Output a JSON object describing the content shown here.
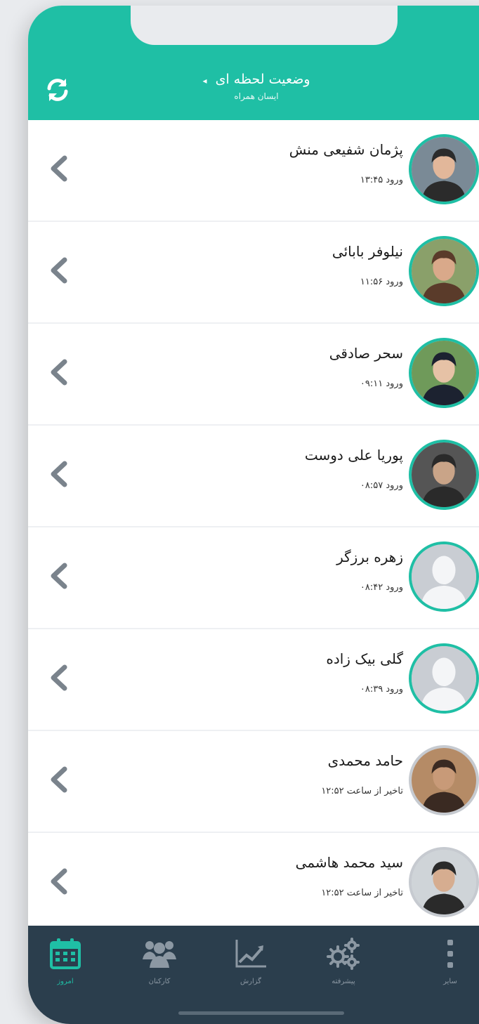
{
  "header": {
    "title": "وضعیت لحظه ای",
    "title_caret": "◂",
    "subtitle": "ایسان همراه"
  },
  "employees": [
    {
      "name": "پژمان شفیعی منش",
      "status": "ورود ۱۳:۴۵",
      "avatar": "photo",
      "border": "green"
    },
    {
      "name": "نیلوفر بابائی",
      "status": "ورود ۱۱:۵۶",
      "avatar": "photo",
      "border": "green"
    },
    {
      "name": "سحر صادقی",
      "status": "ورود ۰۹:۱۱",
      "avatar": "photo",
      "border": "green"
    },
    {
      "name": "پوریا علی دوست",
      "status": "ورود ۰۸:۵۷",
      "avatar": "photo",
      "border": "green"
    },
    {
      "name": "زهره برزگر",
      "status": "ورود ۰۸:۴۲",
      "avatar": "placeholder",
      "border": "green"
    },
    {
      "name": "گلی بیک زاده",
      "status": "ورود ۰۸:۳۹",
      "avatar": "placeholder",
      "border": "green"
    },
    {
      "name": "حامد محمدی",
      "status": "تاخیر از ساعت ۱۲:۵۲",
      "avatar": "photo",
      "border": "gray"
    },
    {
      "name": "سید محمد هاشمی",
      "status": "تاخیر از ساعت ۱۲:۵۲",
      "avatar": "photo",
      "border": "gray"
    }
  ],
  "tabs": [
    {
      "label": "امروز",
      "icon": "calendar-icon",
      "active": true
    },
    {
      "label": "کارکنان",
      "icon": "users-icon",
      "active": false
    },
    {
      "label": "گزارش",
      "icon": "chart-icon",
      "active": false
    },
    {
      "label": "پیشرفته",
      "icon": "gears-icon",
      "active": false
    },
    {
      "label": "سایر",
      "icon": "more-icon",
      "active": false
    }
  ],
  "colors": {
    "accent": "#1fbfa5",
    "tabbar": "#2b3e4d",
    "tab_inactive": "#8c98a3"
  }
}
